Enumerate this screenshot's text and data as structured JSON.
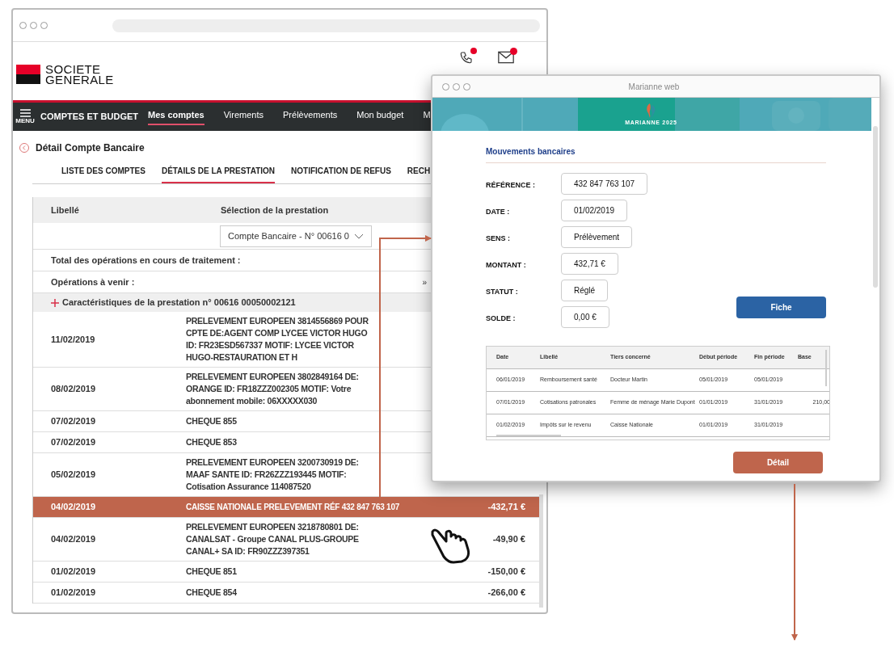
{
  "bank_window": {
    "logo": {
      "line1": "SOCIETE",
      "line2": "GENERALE"
    },
    "nav": {
      "menu_label": "MENU",
      "section": "COMPTES ET BUDGET",
      "items": [
        {
          "label": "Mes comptes",
          "selected": true
        },
        {
          "label": "Virements",
          "selected": false
        },
        {
          "label": "Prélèvements",
          "selected": false
        },
        {
          "label": "Mon budget",
          "selected": false
        },
        {
          "label": "M",
          "selected": false
        }
      ]
    },
    "page_title": "Détail Compte Bancaire",
    "tabs": [
      {
        "label": "LISTE DES COMPTES",
        "selected": false
      },
      {
        "label": "DÉTAILS DE LA PRESTATION",
        "selected": true
      },
      {
        "label": "NOTIFICATION DE REFUS",
        "selected": false
      },
      {
        "label": "RECH",
        "selected": false
      }
    ],
    "table": {
      "columns": [
        "Libellé",
        "Sélection de la prestation"
      ],
      "selector": {
        "value": "Compte Bancaire - N° 00616 0"
      },
      "summary_rows": [
        {
          "label": "Total des opérations en cours de traitement :"
        },
        {
          "label": "Opérations à venir :",
          "trailing": "»"
        }
      ],
      "section": {
        "label": "Caractéristiques de la prestation n° 00616 00050002121",
        "expanded": false
      },
      "rows": [
        {
          "date": "11/02/2019",
          "label": "PRELEVEMENT EUROPEEN 3814556869 POUR CPTE DE:AGENT COMP LYCEE VICTOR HUGO ID: FR23ESD567337 MOTIF: LYCEE VICTOR HUGO-RESTAURATION ET H",
          "selected": false
        },
        {
          "date": "08/02/2019",
          "label": "PRELEVEMENT EUROPEEN 3802849164 DE: ORANGE ID: FR18ZZZ002305 MOTIF: Votre abonnement mobile: 06XXXXX030",
          "selected": false
        },
        {
          "date": "07/02/2019",
          "label": "CHEQUE 855",
          "selected": false
        },
        {
          "date": "07/02/2019",
          "label": "CHEQUE 853",
          "selected": false
        },
        {
          "date": "05/02/2019",
          "label": "PRELEVEMENT EUROPEEN 3200730919 DE: MAAF SANTE ID: FR26ZZZ193445 MOTIF: Cotisation Assurance 114087520",
          "selected": false
        },
        {
          "date": "04/02/2019",
          "label": "CAISSE NATIONALE PRELEVEMENT RÉF 432 847 763 107",
          "amount": "-432,71 €",
          "selected": true
        },
        {
          "date": "04/02/2019",
          "label": "PRELEVEMENT EUROPEEN 3218780801 DE: CANALSAT - Groupe CANAL PLUS-GROUPE CANAL+ SA ID: FR90ZZZ397351",
          "amount": "-49,90 €",
          "selected": false
        },
        {
          "date": "01/02/2019",
          "label": "CHEQUE 851",
          "amount": "-150,00 €",
          "selected": false
        },
        {
          "date": "01/02/2019",
          "label": "CHEQUE 854",
          "amount": "-266,00 €",
          "selected": false
        }
      ]
    }
  },
  "marianne_window": {
    "title": "Marianne web",
    "banner_caption": "MARIANNE 2025",
    "heading": "Mouvements bancaires",
    "fields": [
      {
        "label": "RÉFÉRENCE :",
        "value": "432 847 763 107"
      },
      {
        "label": "DATE :",
        "value": "01/02/2019"
      },
      {
        "label": "SENS :",
        "value": "Prélèvement"
      },
      {
        "label": "MONTANT :",
        "value": "432,71 €"
      },
      {
        "label": "STATUT :",
        "value": "Réglé"
      },
      {
        "label": "SOLDE :",
        "value": "0,00 €"
      }
    ],
    "fiche_button": "Fiche",
    "table": {
      "columns": [
        "Date",
        "Libellé",
        "Tiers concerné",
        "Début période",
        "Fin période",
        "Base"
      ],
      "rows": [
        [
          "06/01/2019",
          "Remboursement santé",
          "Docteur Martin",
          "05/01/2019",
          "05/01/2019",
          ""
        ],
        [
          "07/01/2019",
          "Cotisations patronales",
          "Femme de ménage Marie Dupont",
          "01/01/2019",
          "31/01/2019",
          "210,00"
        ],
        [
          "01/02/2019",
          "Impôts sur le revenu",
          "Caisse Nationale",
          "01/01/2019",
          "31/01/2019",
          ""
        ]
      ]
    },
    "detail_button": "Détail"
  }
}
